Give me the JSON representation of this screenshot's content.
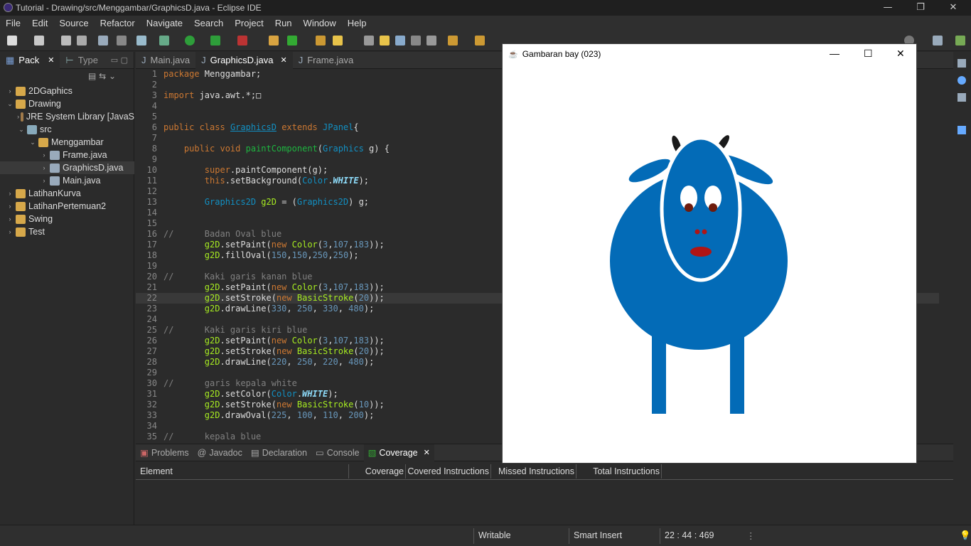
{
  "window": {
    "title": "Tutorial - Drawing/src/Menggambar/GraphicsD.java - Eclipse IDE",
    "minimize": "—",
    "restore": "❐",
    "close": "✕"
  },
  "menu": [
    "File",
    "Edit",
    "Source",
    "Refactor",
    "Navigate",
    "Search",
    "Project",
    "Run",
    "Window",
    "Help"
  ],
  "package_explorer": {
    "tabs": [
      "Pack",
      "Type"
    ],
    "tree": [
      {
        "label": "2DGaphics",
        "indent": 0,
        "arrow": "›"
      },
      {
        "label": "Drawing",
        "indent": 0,
        "arrow": "⌄"
      },
      {
        "label": "JRE System Library [JavaS",
        "indent": 1,
        "arrow": "›"
      },
      {
        "label": "src",
        "indent": 1,
        "arrow": "⌄"
      },
      {
        "label": "Menggambar",
        "indent": 2,
        "arrow": "⌄"
      },
      {
        "label": "Frame.java",
        "indent": 3,
        "arrow": "›"
      },
      {
        "label": "GraphicsD.java",
        "indent": 3,
        "arrow": "›"
      },
      {
        "label": "Main.java",
        "indent": 3,
        "arrow": "›"
      },
      {
        "label": "LatihanKurva",
        "indent": 0,
        "arrow": "›"
      },
      {
        "label": "LatihanPertemuan2",
        "indent": 0,
        "arrow": "›"
      },
      {
        "label": "Swing",
        "indent": 0,
        "arrow": "›"
      },
      {
        "label": "Test",
        "indent": 0,
        "arrow": "›"
      }
    ]
  },
  "editor": {
    "tabs": [
      "Main.java",
      "GraphicsD.java",
      "Frame.java"
    ],
    "lines": [
      "<span class='kw'>package</span> Menggambar;",
      "",
      "<span class='kw'>import</span> java.awt.*;&#9633;",
      "",
      "",
      "<span class='kw'>public class</span> <span class='ty' style='text-decoration:underline'>GraphicsD</span> <span class='kw'>extends</span> <span class='ty'>JPanel</span>{",
      "",
      "    <span class='kw'>public void</span> <span class='fn'>paintComponent</span>(<span class='ty'>Graphics</span> g) {",
      "",
      "        <span class='kw'>super</span>.paintComponent(g);",
      "        <span class='kw'>this</span>.setBackground(<span class='ty'>Color</span>.<span class='it'>WHITE</span>);",
      "",
      "        <span class='ty'>Graphics2D</span> <span class='mt'>g2D</span> = (<span class='ty'>Graphics2D</span>) g;",
      "",
      "",
      "<span class='cm'>//      Badan Oval blue</span>",
      "        <span class='mt'>g2D</span>.setPaint(<span class='kw'>new</span> <span class='mt'>Color</span>(<span class='num'>3</span>,<span class='num'>107</span>,<span class='num'>183</span>));",
      "        <span class='mt'>g2D</span>.fillOval(<span class='num'>150</span>,<span class='num'>150</span>,<span class='num'>250</span>,<span class='num'>250</span>);",
      "",
      "<span class='cm'>//      Kaki garis kanan blue</span>",
      "        <span class='mt'>g2D</span>.setPaint(<span class='kw'>new</span> <span class='mt'>Color</span>(<span class='num'>3</span>,<span class='num'>107</span>,<span class='num'>183</span>));",
      "        <span class='mt'>g2D</span>.setStroke(<span class='kw'>new</span> <span class='mt'>BasicStroke</span>(<span class='num'>20</span>));",
      "        <span class='mt'>g2D</span>.drawLine(<span class='num'>330</span>, <span class='num'>250</span>, <span class='num'>330</span>, <span class='num'>480</span>);",
      "",
      "<span class='cm'>//      Kaki garis kiri blue</span>",
      "        <span class='mt'>g2D</span>.setPaint(<span class='kw'>new</span> <span class='mt'>Color</span>(<span class='num'>3</span>,<span class='num'>107</span>,<span class='num'>183</span>));",
      "        <span class='mt'>g2D</span>.setStroke(<span class='kw'>new</span> <span class='mt'>BasicStroke</span>(<span class='num'>20</span>));",
      "        <span class='mt'>g2D</span>.drawLine(<span class='num'>220</span>, <span class='num'>250</span>, <span class='num'>220</span>, <span class='num'>480</span>);",
      "",
      "<span class='cm'>//      garis kepala white</span>",
      "        <span class='mt'>g2D</span>.setColor(<span class='ty'>Color</span>.<span class='it'>WHITE</span>);",
      "        <span class='mt'>g2D</span>.setStroke(<span class='kw'>new</span> <span class='mt'>BasicStroke</span>(<span class='num'>10</span>));",
      "        <span class='mt'>g2D</span>.drawOval(<span class='num'>225</span>, <span class='num'>100</span>, <span class='num'>110</span>, <span class='num'>200</span>);",
      "",
      "<span class='cm'>//      kepala blue</span>"
    ],
    "highlighted_line": 22
  },
  "bottom": {
    "tabs": [
      "Problems",
      "Javadoc",
      "Declaration",
      "Console",
      "Coverage"
    ],
    "columns": [
      "Element",
      "Coverage",
      "Covered Instructions",
      "Missed Instructions",
      "Total Instructions"
    ]
  },
  "status": {
    "writable": "Writable",
    "insert_mode": "Smart Insert",
    "position": "22 : 44 : 469"
  },
  "java_window": {
    "title": "Gambaran bay (023)",
    "body_color": "#036bb7"
  }
}
